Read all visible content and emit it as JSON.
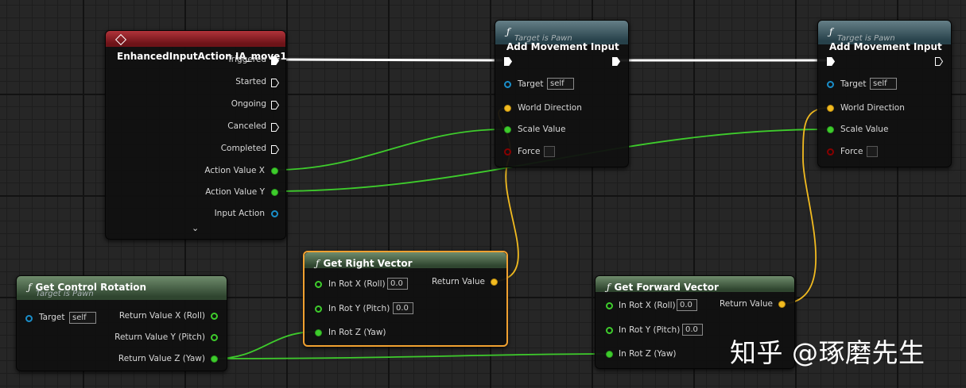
{
  "colors": {
    "exec_wire": "#ffffff",
    "float_wire": "#3ecc2c",
    "vector_wire": "#f2bb20",
    "object_pin": "#1a8ec9",
    "bool_pin": "#880000",
    "event_header": "#b1333a",
    "function_header": "#4f6f7a",
    "pure_header": "#5a7a57",
    "selection": "#f0a030"
  },
  "event_node": {
    "title": "EnhancedInputAction IA_move1",
    "icon": "event-diamond-icon",
    "pins": {
      "triggered": "Triggered",
      "started": "Started",
      "ongoing": "Ongoing",
      "canceled": "Canceled",
      "completed": "Completed",
      "action_value_x": "Action Value X",
      "action_value_y": "Action Value Y",
      "input_action": "Input Action"
    },
    "expand_icon": "⌄"
  },
  "add_movement_1": {
    "title": "Add Movement Input",
    "subtitle": "Target is Pawn",
    "icon": "function-f-icon",
    "target_label": "Target",
    "target_value": "self",
    "world_direction": "World Direction",
    "scale_value": "Scale Value",
    "force": "Force"
  },
  "add_movement_2": {
    "title": "Add Movement Input",
    "subtitle": "Target is Pawn",
    "icon": "function-f-icon",
    "target_label": "Target",
    "target_value": "self",
    "world_direction": "World Direction",
    "scale_value": "Scale Value",
    "force": "Force"
  },
  "get_control_rotation": {
    "title": "Get Control Rotation",
    "subtitle": "Target is Pawn",
    "icon": "function-f-icon",
    "target_label": "Target",
    "target_value": "self",
    "return_x": "Return Value X (Roll)",
    "return_y": "Return Value Y (Pitch)",
    "return_z": "Return Value Z (Yaw)"
  },
  "get_right_vector": {
    "title": "Get Right Vector",
    "icon": "function-f-icon",
    "in_x": "In Rot X (Roll)",
    "in_x_value": "0.0",
    "in_y": "In Rot Y (Pitch)",
    "in_y_value": "0.0",
    "in_z": "In Rot Z (Yaw)",
    "return_value": "Return Value"
  },
  "get_forward_vector": {
    "title": "Get Forward Vector",
    "icon": "function-f-icon",
    "in_x": "In Rot X (Roll)",
    "in_x_value": "0.0",
    "in_y": "In Rot Y (Pitch)",
    "in_y_value": "0.0",
    "in_z": "In Rot Z (Yaw)",
    "return_value": "Return Value"
  },
  "watermark": "知乎 @琢磨先生"
}
